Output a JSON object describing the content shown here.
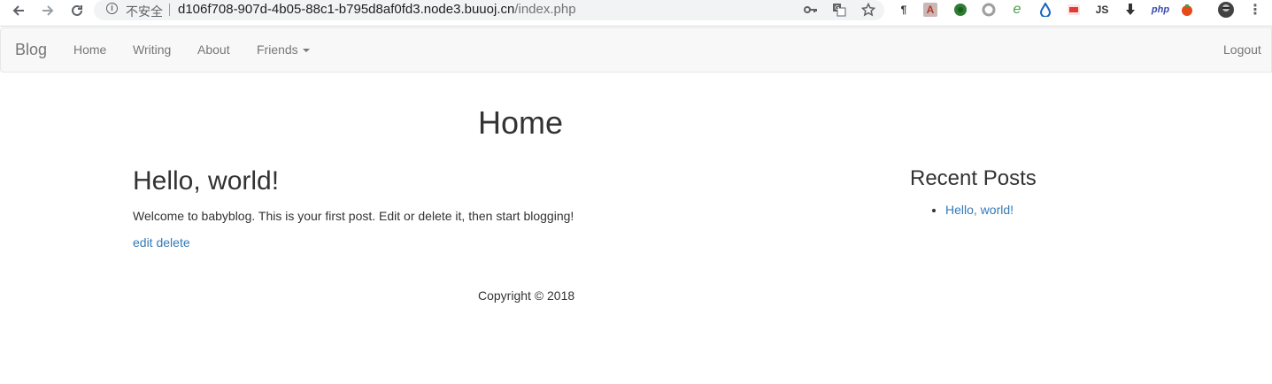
{
  "browser": {
    "back_icon": "arrow-left",
    "forward_icon": "arrow-right",
    "reload_icon": "reload",
    "security_text": "不安全",
    "url_host": "d106f708-907d-4b05-88c1-b795d8af0fd3.node3.buuoj.cn",
    "url_path": "/index.php",
    "omnibox_icons": [
      "key-icon",
      "translate-icon",
      "star-icon"
    ],
    "extensions": [
      {
        "name": "pilcrow-ext",
        "glyph": "¶",
        "color": "#333333"
      },
      {
        "name": "pdf-ext",
        "glyph": "A",
        "color": "#b03a2e"
      },
      {
        "name": "green-globe-ext",
        "glyph": "●",
        "color": "#2e7d32"
      },
      {
        "name": "gray-ring-ext",
        "glyph": "○",
        "color": "#9e9e9e"
      },
      {
        "name": "green-e-ext",
        "glyph": "e",
        "color": "#43a047"
      },
      {
        "name": "drop-ext",
        "glyph": "💧",
        "color": "#1565c0"
      },
      {
        "name": "red-badge-ext",
        "glyph": "▣",
        "color": "#e53935"
      },
      {
        "name": "js-ext",
        "glyph": "JS",
        "color": "#333333"
      },
      {
        "name": "download-ext",
        "glyph": "⬇",
        "color": "#333333"
      },
      {
        "name": "php-ext",
        "glyph": "php",
        "color": "#3949ab"
      },
      {
        "name": "tomato-ext",
        "glyph": "●",
        "color": "#e64a19"
      }
    ],
    "menu_icon": "more-vert"
  },
  "navbar": {
    "brand": "Blog",
    "links": [
      "Home",
      "Writing",
      "About",
      "Friends"
    ],
    "logout": "Logout"
  },
  "main": {
    "page_title": "Home",
    "post": {
      "title": "Hello, world!",
      "body": "Welcome to babyblog. This is your first post. Edit or delete it, then start blogging!",
      "edit": "edit",
      "delete": "delete"
    },
    "sidebar": {
      "title": "Recent Posts",
      "items": [
        "Hello, world!"
      ]
    }
  },
  "footer": {
    "copyright": "Copyright © 2018"
  },
  "colors": {
    "link": "#337ab7",
    "navbar_bg": "#f8f8f8",
    "nav_text": "#777777"
  }
}
